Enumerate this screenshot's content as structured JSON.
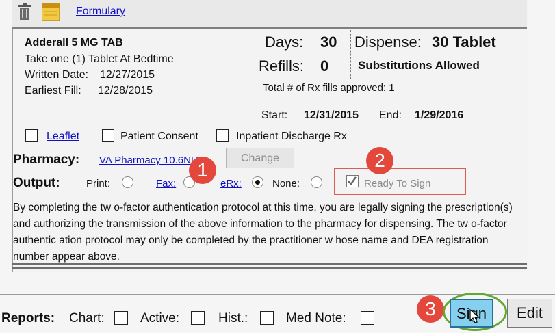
{
  "toolbar": {
    "formulary_link": "Formulary",
    "trash_icon": "trash-icon",
    "note_icon": "note-icon"
  },
  "prescription": {
    "drug_name": "Adderall 5 MG TAB",
    "instructions": "Take one (1) Tablet At Bedtime",
    "written_date_label": "Written Date:",
    "written_date": "12/27/2015",
    "earliest_fill_label": "Earliest Fill:",
    "earliest_fill": "12/28/2015",
    "days_label": "Days:",
    "days": "30",
    "refills_label": "Refills:",
    "refills": "0",
    "dispense_label": "Dispense:",
    "dispense": "30 Tablet",
    "substitutions": "Substitutions Allowed",
    "total_fills": "Total # of Rx fills approved: 1",
    "start_label": "Start:",
    "start": "12/31/2015",
    "end_label": "End:",
    "end": "1/29/2016"
  },
  "options": {
    "leaflet": "Leaflet",
    "patient_consent": "Patient Consent",
    "inpatient_discharge": "Inpatient Discharge Rx"
  },
  "pharmacy": {
    "label": "Pharmacy:",
    "name": "VA Pharmacy 10.6NU",
    "change_button": "Change"
  },
  "output": {
    "label": "Output:",
    "print": "Print:",
    "fax": "Fax:",
    "erx": "eRx:",
    "none": "None:",
    "selected": "eRx",
    "ready_to_sign": "Ready To Sign"
  },
  "disclaimer": "By completing the tw o-factor authentication protocol at this time, you are legally signing the prescription(s) and authorizing the transmission of the above information to the pharmacy for dispensing. The tw o-factor authentic ation protocol may only be completed by the practitioner w hose name and DEA registration number appear above.",
  "reports": {
    "label": "Reports:",
    "chart": "Chart:",
    "active": "Active:",
    "hist": "Hist.:",
    "med_note": "Med Note:"
  },
  "buttons": {
    "sign": "Sign",
    "edit": "Edit"
  },
  "markers": [
    "1",
    "2",
    "3"
  ],
  "colors": {
    "link": "#1010c8",
    "marker": "#e4473b",
    "sign_bg": "#87cfee",
    "sign_ring": "#60a830"
  }
}
